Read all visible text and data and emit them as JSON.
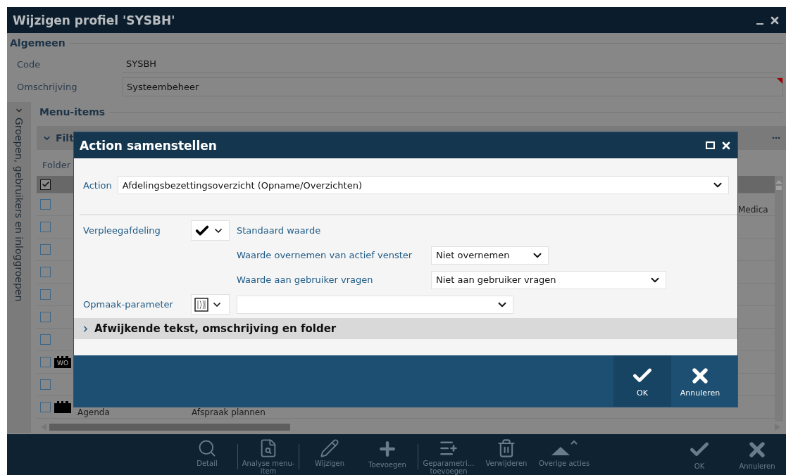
{
  "window": {
    "title": "Wijzigen profiel 'SYSBH'"
  },
  "general": {
    "heading": "Algemeen",
    "fields": [
      {
        "label": "Code",
        "value": "SYSBH",
        "kind": "plain"
      },
      {
        "label": "Omschrijving",
        "value": "Systeembeheer",
        "kind": "input",
        "required": true
      }
    ]
  },
  "side_tab": {
    "label": "Groepen, gebruikers en inloggroepen"
  },
  "menu_items": {
    "heading": "Menu-items",
    "filter_label": "Filt",
    "folder_label": "Folder",
    "header_checked": true,
    "rows": [
      {
        "checked": false,
        "kind": "plain",
        "column_3": "Medica"
      },
      {
        "checked": false,
        "kind": "plain"
      },
      {
        "checked": false,
        "kind": "plain"
      },
      {
        "checked": false,
        "kind": "plain"
      },
      {
        "checked": false,
        "kind": "plain"
      },
      {
        "checked": false,
        "kind": "plain"
      },
      {
        "checked": false,
        "kind": "plain"
      },
      {
        "checked": false,
        "kind": "item",
        "icon_text": "WO"
      },
      {
        "checked": false,
        "kind": "plain"
      },
      {
        "checked": false,
        "kind": "item",
        "name": "Agenda",
        "action": "Afspraak plannen"
      }
    ]
  },
  "toolbar": [
    {
      "label": "Detail",
      "kind": "search",
      "separator_after": true
    },
    {
      "label": "Analyse menu-item",
      "kind": "analyse",
      "separator_after": true
    },
    {
      "label": "Wijzigen",
      "kind": "edit"
    },
    {
      "label": "Toevoegen",
      "kind": "add",
      "separator_after": true
    },
    {
      "label": "Geparametri... toevoegen",
      "kind": "param"
    },
    {
      "label": "Verwijderen",
      "kind": "delete"
    },
    {
      "label": "Overige acties",
      "kind": "more"
    }
  ],
  "toolbar_right": [
    {
      "label": "OK",
      "kind": "ok"
    },
    {
      "label": "Annuleren",
      "kind": "cancel"
    }
  ],
  "dialog": {
    "title": "Action samenstellen",
    "action_label": "Action",
    "action_value": "Afdelingsbezettingsoverzicht (Opname/Overzichten)",
    "parameter": {
      "label": "Verpleegafdeling",
      "default_label": "Standaard waarde",
      "options": [
        {
          "label": "Waarde overnemen van actief venster",
          "value": "Niet overnemen"
        },
        {
          "label": "Waarde aan gebruiker vragen",
          "value": "Niet aan gebruiker vragen"
        }
      ]
    },
    "format": {
      "label": "Opmaak-parameter"
    },
    "expander": {
      "label": "Afwijkende tekst, omschrijving en folder",
      "expanded": false
    },
    "buttons": [
      {
        "label": "OK",
        "kind": "ok",
        "selected": true
      },
      {
        "label": "Annuleren",
        "kind": "cancel",
        "selected": false
      }
    ]
  }
}
